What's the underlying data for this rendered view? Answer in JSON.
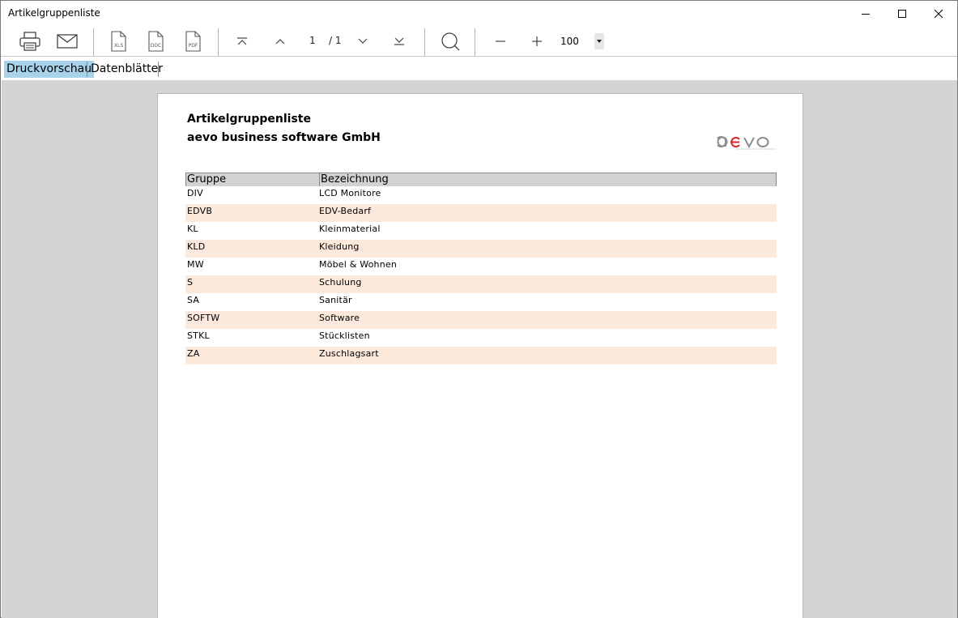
{
  "window": {
    "title": "Artikelgruppenliste"
  },
  "toolbar": {
    "page_current": "1",
    "page_total": "/ 1",
    "zoom": "100"
  },
  "tabs": [
    {
      "label": "Druckvorschau",
      "active": true
    },
    {
      "label": "Datenblätter",
      "active": false
    }
  ],
  "report": {
    "title": "Artikelgruppenliste",
    "company": "aevo business software GmbH",
    "logo_text": "aevo",
    "columns": [
      "Gruppe",
      "Bezeichnung"
    ],
    "rows": [
      {
        "gruppe": "DIV",
        "bezeichnung": "LCD Monitore"
      },
      {
        "gruppe": "EDVB",
        "bezeichnung": "EDV-Bedarf"
      },
      {
        "gruppe": "KL",
        "bezeichnung": "Kleinmaterial"
      },
      {
        "gruppe": "KLD",
        "bezeichnung": "Kleidung"
      },
      {
        "gruppe": "MW",
        "bezeichnung": "Möbel & Wohnen"
      },
      {
        "gruppe": "S",
        "bezeichnung": "Schulung"
      },
      {
        "gruppe": "SA",
        "bezeichnung": "Sanitär"
      },
      {
        "gruppe": "SOFTW",
        "bezeichnung": "Software"
      },
      {
        "gruppe": "STKL",
        "bezeichnung": "Stücklisten"
      },
      {
        "gruppe": "ZA",
        "bezeichnung": "Zuschlagsart"
      }
    ]
  },
  "colors": {
    "tab_active": "#a8d1ea",
    "row_alt": "#fce9dc",
    "header_bg": "#d2d2d2",
    "preview_bg": "#d4d4d4",
    "logo_red": "#d9262b",
    "logo_gray": "#8c8c8c"
  }
}
